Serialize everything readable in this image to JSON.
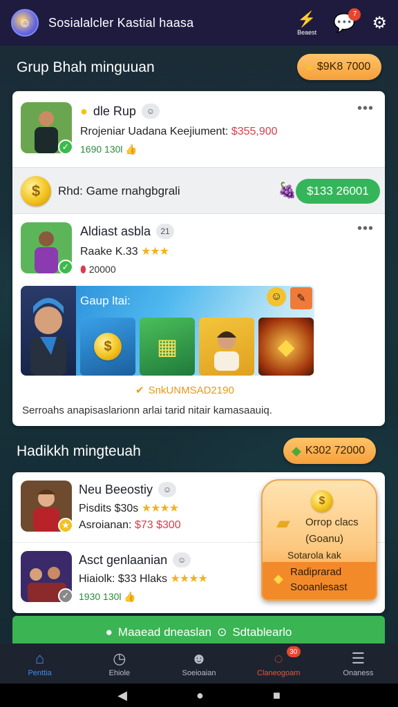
{
  "header": {
    "title": "Sosialalcler Kastial haasa",
    "icon_labels": [
      "Beaest"
    ],
    "notification_count": "7"
  },
  "section1": {
    "title": "Grup Bhah minguuan",
    "pill": "$9K8 7000",
    "rows": [
      {
        "name": "dle Rup",
        "line": "Rrojeniar Uadana Keejiument:",
        "amount": "$355,900",
        "small": "1690 130l"
      },
      {
        "strip_text": "Rhd: Game rnahgbgrali",
        "strip_value": "$133 26001"
      },
      {
        "name": "Aldiast asbla",
        "chip": "21",
        "line": "Raake K.33",
        "small": "20000"
      }
    ],
    "banner": {
      "title": "Gaup ltai:",
      "promo": "SnkUNMSAD2190",
      "description": "Serroahs anapisaslarionn arlai tarid nitair kamasaauiq."
    }
  },
  "section2": {
    "title": "Hadikkh mingteuah",
    "pill": "K302 72000",
    "rows": [
      {
        "name": "Neu Beeostiy",
        "line": "Pisdits $30s",
        "sub_label": "Asroianan:",
        "sub_amount": "$73 $300"
      },
      {
        "name": "Asct genlaanian",
        "line": "Hiaiolk: $33 Hlaks",
        "small": "1930 130l"
      }
    ],
    "popup": {
      "line1": "Orrop clacs",
      "line2": "(Goanu)",
      "line3": "Sotarola kak",
      "line4": "Radiprarad",
      "line5": "Sooanlesast"
    },
    "cta": "Maaead dneaslan",
    "cta_suffix": "Sdtablearlo"
  },
  "nav": {
    "items": [
      {
        "label": "Penttia",
        "icon": "home-icon"
      },
      {
        "label": "Ehiole",
        "icon": "clock-icon"
      },
      {
        "label": "Soeioaian",
        "icon": "people-icon"
      },
      {
        "label": "Claneogoam",
        "icon": "chat-icon",
        "badge": "30"
      },
      {
        "label": "Onaness",
        "icon": "menu-icon"
      }
    ]
  },
  "colors": {
    "topbar": "#1e1b3f",
    "accent_orange": "#f5a03b",
    "accent_green": "#34b55a",
    "nav_active": "#3d8ef0"
  }
}
